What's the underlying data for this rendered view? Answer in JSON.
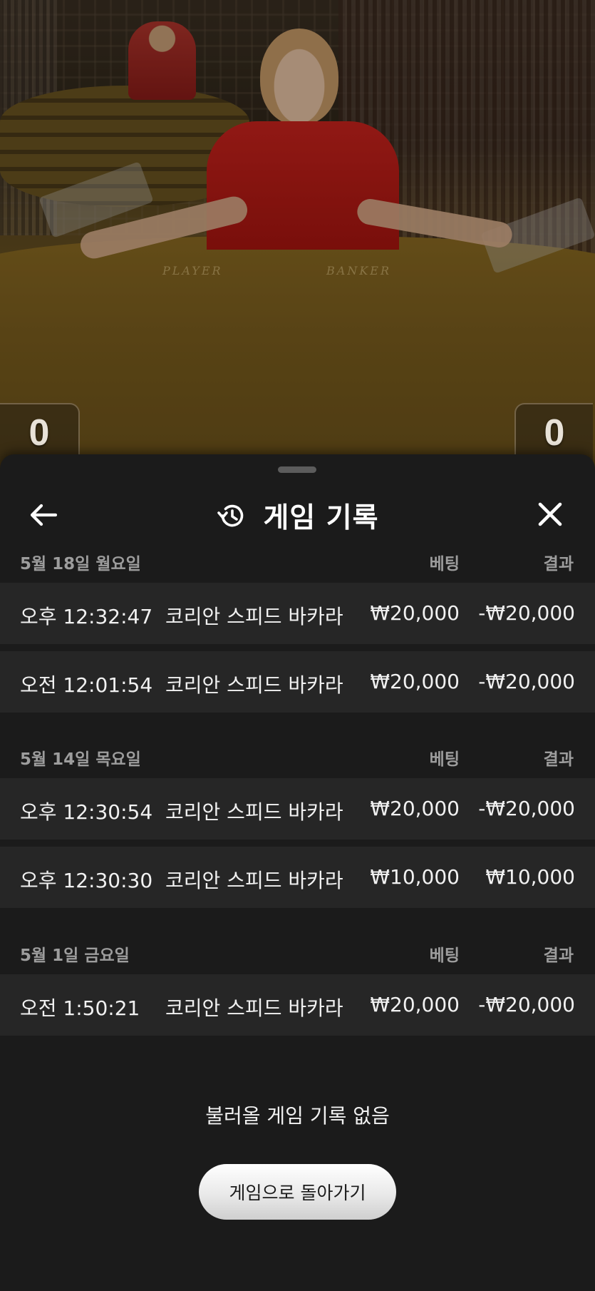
{
  "scene": {
    "player_label": "PLAYER",
    "banker_label": "BANKER",
    "player_score": "0",
    "banker_score": "0"
  },
  "header": {
    "title": "게임 기록",
    "back_icon": "arrow-left-icon",
    "history_icon": "history-icon",
    "close_icon": "close-icon"
  },
  "groups": [
    {
      "date": "5월 18일 월요일",
      "bet_header": "베팅",
      "result_header": "결과",
      "rows": [
        {
          "time": "오후 12:32:47",
          "game": "코리안 스피드 바카라",
          "bet": "₩20,000",
          "result": "-₩20,000"
        },
        {
          "time": "오전 12:01:54",
          "game": "코리안 스피드 바카라",
          "bet": "₩20,000",
          "result": "-₩20,000"
        }
      ]
    },
    {
      "date": "5월 14일 목요일",
      "bet_header": "베팅",
      "result_header": "결과",
      "rows": [
        {
          "time": "오후 12:30:54",
          "game": "코리안 스피드 바카라",
          "bet": "₩20,000",
          "result": "-₩20,000"
        },
        {
          "time": "오후 12:30:30",
          "game": "코리안 스피드 바카라",
          "bet": "₩10,000",
          "result": "₩10,000"
        }
      ]
    },
    {
      "date": "5월 1일 금요일",
      "bet_header": "베팅",
      "result_header": "결과",
      "rows": [
        {
          "time": "오전 1:50:21",
          "game": "코리안 스피드 바카라",
          "bet": "₩20,000",
          "result": "-₩20,000"
        }
      ]
    }
  ],
  "empty_message": "불러올 게임 기록 없음",
  "return_button": "게임으로 돌아가기",
  "colors": {
    "sheet_bg": "#1b1b1b",
    "row_bg": "#262626",
    "muted_text": "#9d9d9d"
  }
}
